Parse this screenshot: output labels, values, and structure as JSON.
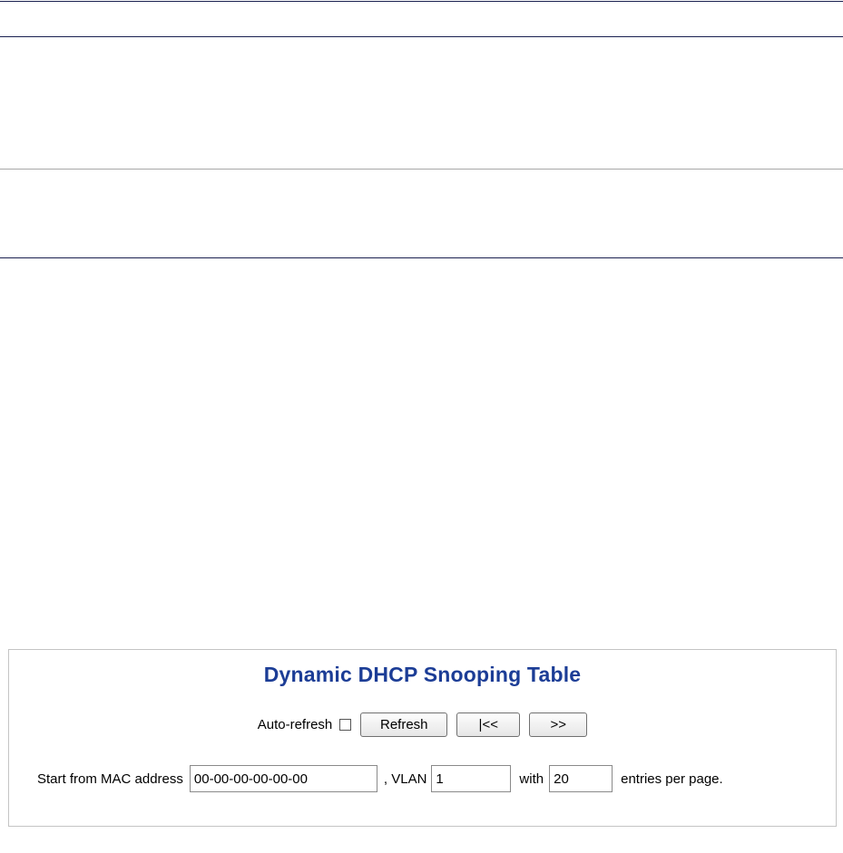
{
  "panel": {
    "title": "Dynamic DHCP Snooping Table",
    "toolbar": {
      "auto_refresh_label": "Auto-refresh",
      "auto_refresh_checked": false,
      "refresh_label": "Refresh",
      "first_page_label": "|<<",
      "next_page_label": ">>"
    },
    "start_form": {
      "mac_label": "Start from MAC address",
      "mac_value": "00-00-00-00-00-00",
      "vlan_label": ", VLAN",
      "vlan_value": "1",
      "with_label": "with",
      "entries_value": "20",
      "entries_suffix": "entries per page."
    }
  }
}
